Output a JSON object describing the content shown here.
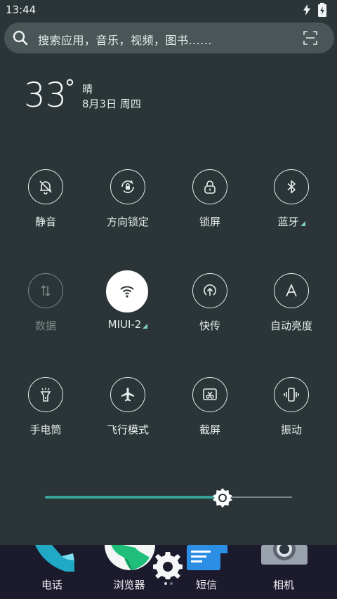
{
  "status_bar": {
    "time": "13:44",
    "icons": [
      "charging-bolt-icon",
      "battery-icon"
    ]
  },
  "search": {
    "placeholder": "搜索应用，音乐，视频，图书......",
    "icons": [
      "search-icon",
      "scan-icon"
    ]
  },
  "weather": {
    "temperature": "33",
    "degree": "°",
    "condition": "晴",
    "date": "8月3日 周四"
  },
  "toggles": [
    {
      "label": "静音",
      "icon": "bell-off-icon",
      "state": "off"
    },
    {
      "label": "方向锁定",
      "icon": "rotation-lock-icon",
      "state": "off"
    },
    {
      "label": "锁屏",
      "icon": "lock-icon",
      "state": "off"
    },
    {
      "label": "蓝牙",
      "icon": "bluetooth-icon",
      "state": "off"
    },
    {
      "label": "数据",
      "icon": "data-arrows-icon",
      "state": "disabled"
    },
    {
      "label": "MIUI-2",
      "icon": "wifi-icon",
      "state": "on"
    },
    {
      "label": "快传",
      "icon": "share-upload-icon",
      "state": "off"
    },
    {
      "label": "自动亮度",
      "icon": "auto-brightness-icon",
      "state": "off"
    },
    {
      "label": "手电筒",
      "icon": "flashlight-icon",
      "state": "off"
    },
    {
      "label": "飞行模式",
      "icon": "airplane-icon",
      "state": "off"
    },
    {
      "label": "截屏",
      "icon": "screenshot-icon",
      "state": "off"
    },
    {
      "label": "振动",
      "icon": "vibrate-icon",
      "state": "off"
    }
  ],
  "brightness": {
    "level": 0.72
  },
  "dock": {
    "apps": [
      {
        "label": "电话",
        "icon": "phone-icon"
      },
      {
        "label": "浏览器",
        "icon": "browser-globe-icon"
      },
      {
        "label": "短信",
        "icon": "messages-icon"
      },
      {
        "label": "相机",
        "icon": "camera-icon"
      }
    ],
    "settings_icon": "gear-icon",
    "accent_colors": {
      "phone": "#1fa9c4",
      "browser": "#1fbf7a",
      "messages": "#2c8fe6",
      "camera": "#9aa2ad"
    }
  },
  "colors": {
    "background": "#2b3537",
    "slider_fill": "#38a39a",
    "dock_bg": "#1c1a2d"
  }
}
